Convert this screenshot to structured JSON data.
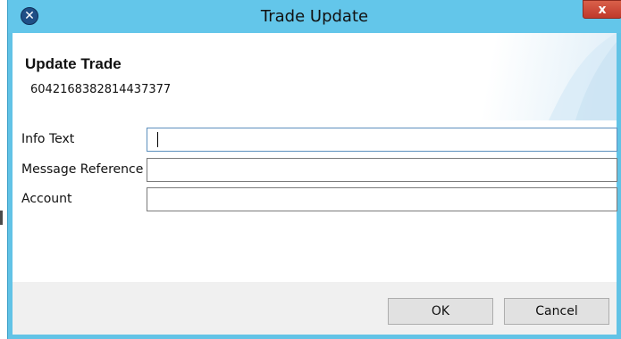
{
  "window": {
    "title": "Trade Update",
    "close_label": "x",
    "app_icon_glyph": "✕",
    "accent_color": "#63c6ea"
  },
  "header": {
    "title": "Update Trade",
    "subtitle": "6042168382814437377"
  },
  "form": {
    "fields": [
      {
        "label": "Info Text",
        "value": "",
        "focused": true
      },
      {
        "label": "Message Reference",
        "value": ""
      },
      {
        "label": "Account",
        "value": ""
      }
    ]
  },
  "buttons": {
    "ok_label": "OK",
    "cancel_label": "Cancel"
  }
}
